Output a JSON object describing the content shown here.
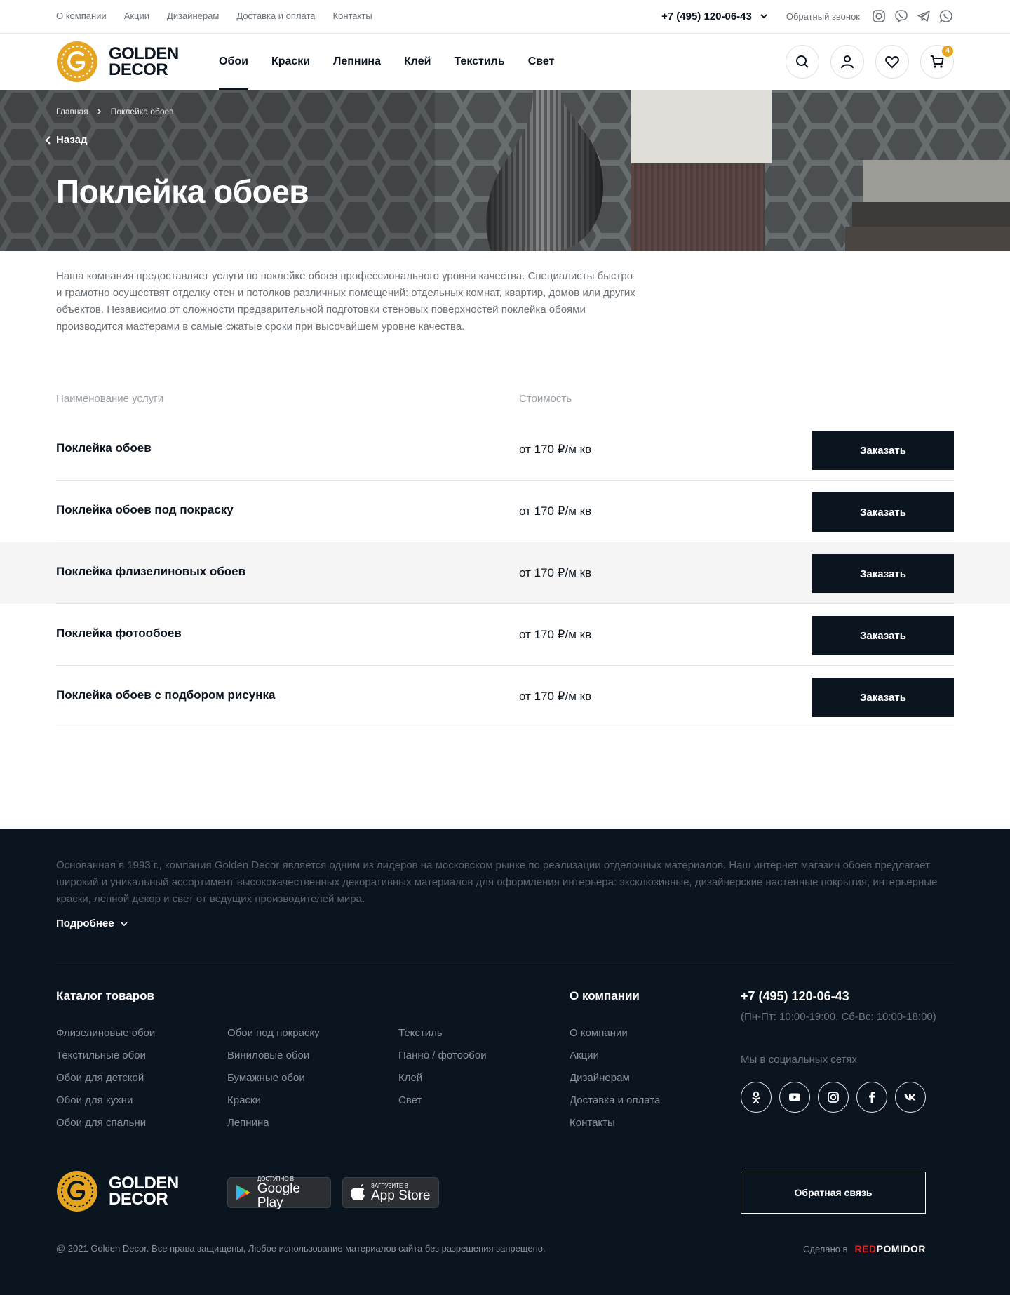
{
  "topbar": {
    "links": [
      "О компании",
      "Акции",
      "Дизайнерам",
      "Доставка и оплата",
      "Контакты"
    ],
    "phone": "+7 (495) 120-06-43",
    "callback": "Обратный звонок"
  },
  "brand": {
    "line1": "GOLDEN",
    "line2": "DECOR",
    "accent": "#e5a520"
  },
  "nav": {
    "items": [
      "Обои",
      "Краски",
      "Лепнина",
      "Клей",
      "Текстиль",
      "Свет"
    ],
    "active": "Обои"
  },
  "cart": {
    "count": "4"
  },
  "breadcrumbs": [
    "Главная",
    "Поклейка обоев"
  ],
  "back_label": "Назад",
  "page_title": "Поклейка обоев",
  "intro": "Наша компания предоставляет услуги по поклейке обоев профессионального уровня качества. Специалисты быстро и грамотно осуществят отделку стен и потолков различных помещений: отдельных комнат, квартир, домов или других объектов. Независимо от сложности предварительной подготовки стеновых поверхностей поклейка обоями производится мастерами в самые сжатые сроки при высочайшем уровне качества.",
  "table": {
    "col_name": "Наименование услуги",
    "col_price": "Стоимость",
    "rows": [
      {
        "name": "Поклейка обоев",
        "price": "от 170 ₽/м кв",
        "button": "Заказать"
      },
      {
        "name": "Поклейка обоев под покраску",
        "price": "от 170 ₽/м кв",
        "button": "Заказать"
      },
      {
        "name": "Поклейка флизелиновых обоев",
        "price": "от 170 ₽/м кв",
        "button": "Заказать"
      },
      {
        "name": "Поклейка фотообоев",
        "price": "от 170 ₽/м кв",
        "button": "Заказать"
      },
      {
        "name": "Поклейка обоев с подбором рисунка",
        "price": "от 170 ₽/м кв",
        "button": "Заказать"
      }
    ]
  },
  "footer": {
    "about": "Основанная в 1993 г., компания Golden Decor является одним из лидеров на московском рынке по реализации отделочных материалов. Наш интернет магазин обоев предлагает широкий и уникальный ассортимент высококачественных декоративных материалов для оформления интерьера: эксклюзивные, дизайнерские настенные покрытия, интерьерные краски, лепной декор и свет от ведущих производителей мира.",
    "more": "Подробнее",
    "catalog_title": "Каталог товаров",
    "catalog_col1": [
      "Флизелиновые обои",
      "Текстильные обои",
      "Обои для детской",
      "Обои для кухни",
      "Обои для спальни"
    ],
    "catalog_col2": [
      "Обои под покраску",
      "Виниловые обои",
      "Бумажные обои",
      "Краски",
      "Лепнина"
    ],
    "catalog_col3": [
      "Текстиль",
      "Панно / фотообои",
      "Клей",
      "Свет"
    ],
    "company_title": "О компании",
    "company_links": [
      "О компании",
      "Акции",
      "Дизайнерам",
      "Доставка и оплата",
      "Контакты"
    ],
    "phone": "+7 (495) 120-06-43",
    "hours": "(Пн-Пт: 10:00-19:00, Сб-Вс: 10:00-18:00)",
    "social_label": "Мы в социальных сетях",
    "google_small": "ДОСТУПНО В",
    "google_big": "Google Play",
    "apple_small": "Загрузите в",
    "apple_big": "App Store",
    "feedback_button": "Обратная связь",
    "copyright": "@ 2021 Golden Decor. Все права защищены, Любое использование материалов сайта без разрешения запрещено.",
    "made_in": "Сделано в",
    "made_by_red": "RED",
    "made_by_white": "POMIDOR"
  }
}
